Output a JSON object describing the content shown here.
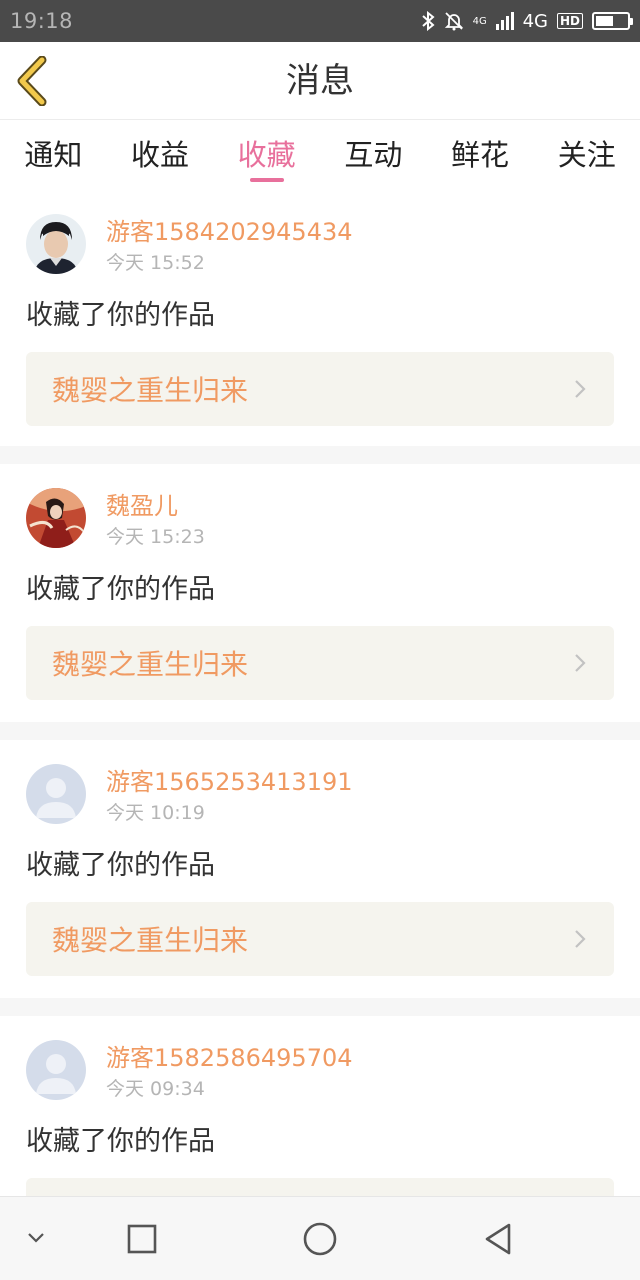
{
  "status_bar": {
    "time": "19:18",
    "network_small": "4G",
    "network": "4G",
    "hd": "HD",
    "icons": [
      "bluetooth-icon",
      "mute-bell-icon",
      "signal-icon",
      "battery-icon"
    ],
    "battery_level": 0.55
  },
  "header": {
    "title": "消息",
    "back_icon": "chevron-left-icon",
    "back_color": "#f2c94c"
  },
  "tabs": [
    {
      "label": "通知",
      "active": false
    },
    {
      "label": "收益",
      "active": false
    },
    {
      "label": "收藏",
      "active": true
    },
    {
      "label": "互动",
      "active": false
    },
    {
      "label": "鲜花",
      "active": false
    },
    {
      "label": "关注",
      "active": false
    }
  ],
  "colors": {
    "accent_pink": "#e8709c",
    "username_orange": "#f09a62",
    "card_bg": "#f5f4ee"
  },
  "messages": [
    {
      "username": "游客1584202945434",
      "time": "今天 15:52",
      "action": "收藏了你的作品",
      "work_title": "魏婴之重生归来",
      "avatar": "photo-avatar"
    },
    {
      "username": "魏盈儿",
      "time": "今天 15:23",
      "action": "收藏了你的作品",
      "work_title": "魏婴之重生归来",
      "avatar": "illustration-avatar"
    },
    {
      "username": "游客1565253413191",
      "time": "今天 10:19",
      "action": "收藏了你的作品",
      "work_title": "魏婴之重生归来",
      "avatar": "default-avatar"
    },
    {
      "username": "游客1582586495704",
      "time": "今天 09:34",
      "action": "收藏了你的作品",
      "work_title": "",
      "avatar": "default-avatar"
    }
  ],
  "system_nav": {
    "icons": [
      "collapse-chevron-icon",
      "recent-apps-icon",
      "home-icon",
      "back-triangle-icon"
    ]
  }
}
